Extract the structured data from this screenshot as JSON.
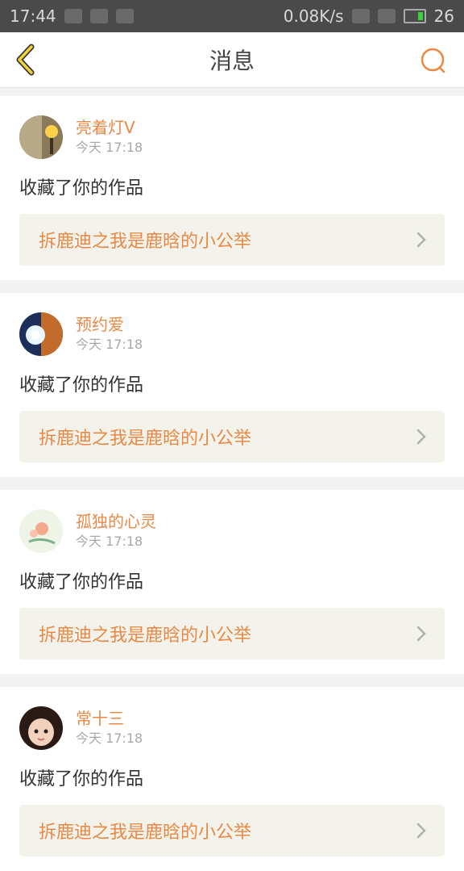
{
  "status": {
    "time": "17:44",
    "battery_pct": "26",
    "network": "0.08K/s"
  },
  "header": {
    "title": "消息"
  },
  "colors": {
    "accent": "#e98945",
    "link_bg": "#f3f3ec",
    "chevron": "#b0b0b0"
  },
  "messages": [
    {
      "user": "亮着灯V",
      "time": "今天 17:18",
      "action": "收藏了你的作品",
      "work": "拆鹿迪之我是鹿晗的小公举",
      "avatar_icon": "lamp-avatar-icon"
    },
    {
      "user": "预约爱",
      "time": "今天 17:18",
      "action": "收藏了你的作品",
      "work": "拆鹿迪之我是鹿晗的小公举",
      "avatar_icon": "light-burst-avatar-icon"
    },
    {
      "user": "孤独的心灵",
      "time": "今天 17:18",
      "action": "收藏了你的作品",
      "work": "拆鹿迪之我是鹿晗的小公举",
      "avatar_icon": "flower-avatar-icon"
    },
    {
      "user": "常十三",
      "time": "今天 17:18",
      "action": "收藏了你的作品",
      "work": "拆鹿迪之我是鹿晗的小公举",
      "avatar_icon": "child-face-avatar-icon"
    }
  ]
}
